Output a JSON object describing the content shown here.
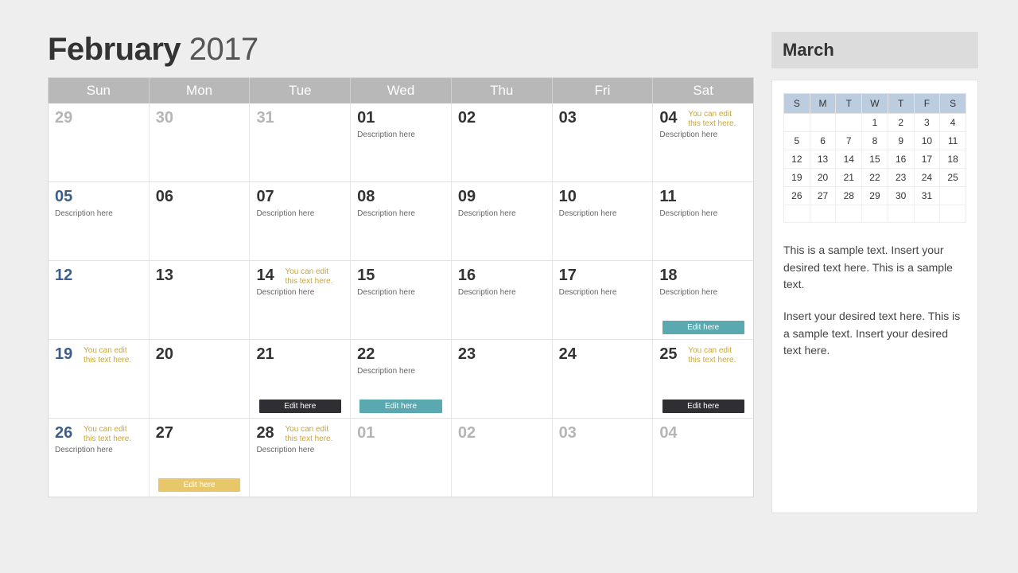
{
  "title": {
    "month": "February",
    "year": "2017"
  },
  "weekdays": [
    "Sun",
    "Mon",
    "Tue",
    "Wed",
    "Thu",
    "Fri",
    "Sat"
  ],
  "noteText": "You can edit this text here.",
  "descText": "Description here",
  "editHere": "Edit here",
  "rows": [
    [
      {
        "n": "29",
        "dim": true
      },
      {
        "n": "30",
        "dim": true
      },
      {
        "n": "31",
        "dim": true
      },
      {
        "n": "01",
        "desc": true
      },
      {
        "n": "02"
      },
      {
        "n": "03"
      },
      {
        "n": "04",
        "note": true,
        "desc": true
      }
    ],
    [
      {
        "n": "05",
        "sun": true,
        "desc": true
      },
      {
        "n": "06"
      },
      {
        "n": "07",
        "desc": true
      },
      {
        "n": "08",
        "desc": true
      },
      {
        "n": "09",
        "desc": true
      },
      {
        "n": "10",
        "desc": true
      },
      {
        "n": "11",
        "desc": true
      }
    ],
    [
      {
        "n": "12",
        "sun": true
      },
      {
        "n": "13"
      },
      {
        "n": "14",
        "note": true,
        "desc": true
      },
      {
        "n": "15",
        "desc": true
      },
      {
        "n": "16",
        "desc": true
      },
      {
        "n": "17",
        "desc": true
      },
      {
        "n": "18",
        "desc": true,
        "tag": "teal"
      }
    ],
    [
      {
        "n": "19",
        "sun": true,
        "note": true
      },
      {
        "n": "20"
      },
      {
        "n": "21",
        "tag": "dark"
      },
      {
        "n": "22",
        "desc": true,
        "tag": "teal"
      },
      {
        "n": "23"
      },
      {
        "n": "24"
      },
      {
        "n": "25",
        "note": true,
        "tag": "dark"
      }
    ],
    [
      {
        "n": "26",
        "sun": true,
        "note": true,
        "desc": true
      },
      {
        "n": "27",
        "tag": "yellow"
      },
      {
        "n": "28",
        "note": true,
        "desc": true
      },
      {
        "n": "01",
        "dim": true
      },
      {
        "n": "02",
        "dim": true
      },
      {
        "n": "03",
        "dim": true
      },
      {
        "n": "04",
        "dim": true
      }
    ]
  ],
  "side": {
    "title": "March",
    "miniHead": [
      "S",
      "M",
      "T",
      "W",
      "T",
      "F",
      "S"
    ],
    "miniRows": [
      [
        "",
        "",
        "",
        "1",
        "2",
        "3",
        "4"
      ],
      [
        "5",
        "6",
        "7",
        "8",
        "9",
        "10",
        "11"
      ],
      [
        "12",
        "13",
        "14",
        "15",
        "16",
        "17",
        "18"
      ],
      [
        "19",
        "20",
        "21",
        "22",
        "23",
        "24",
        "25"
      ],
      [
        "26",
        "27",
        "28",
        "29",
        "30",
        "31",
        ""
      ],
      [
        "",
        "",
        "",
        "",
        "",
        "",
        ""
      ]
    ],
    "para1": "This is a sample text. Insert your desired text here. This is a sample text.",
    "para2": "Insert your desired text here. This is a sample text. Insert your desired text here."
  }
}
